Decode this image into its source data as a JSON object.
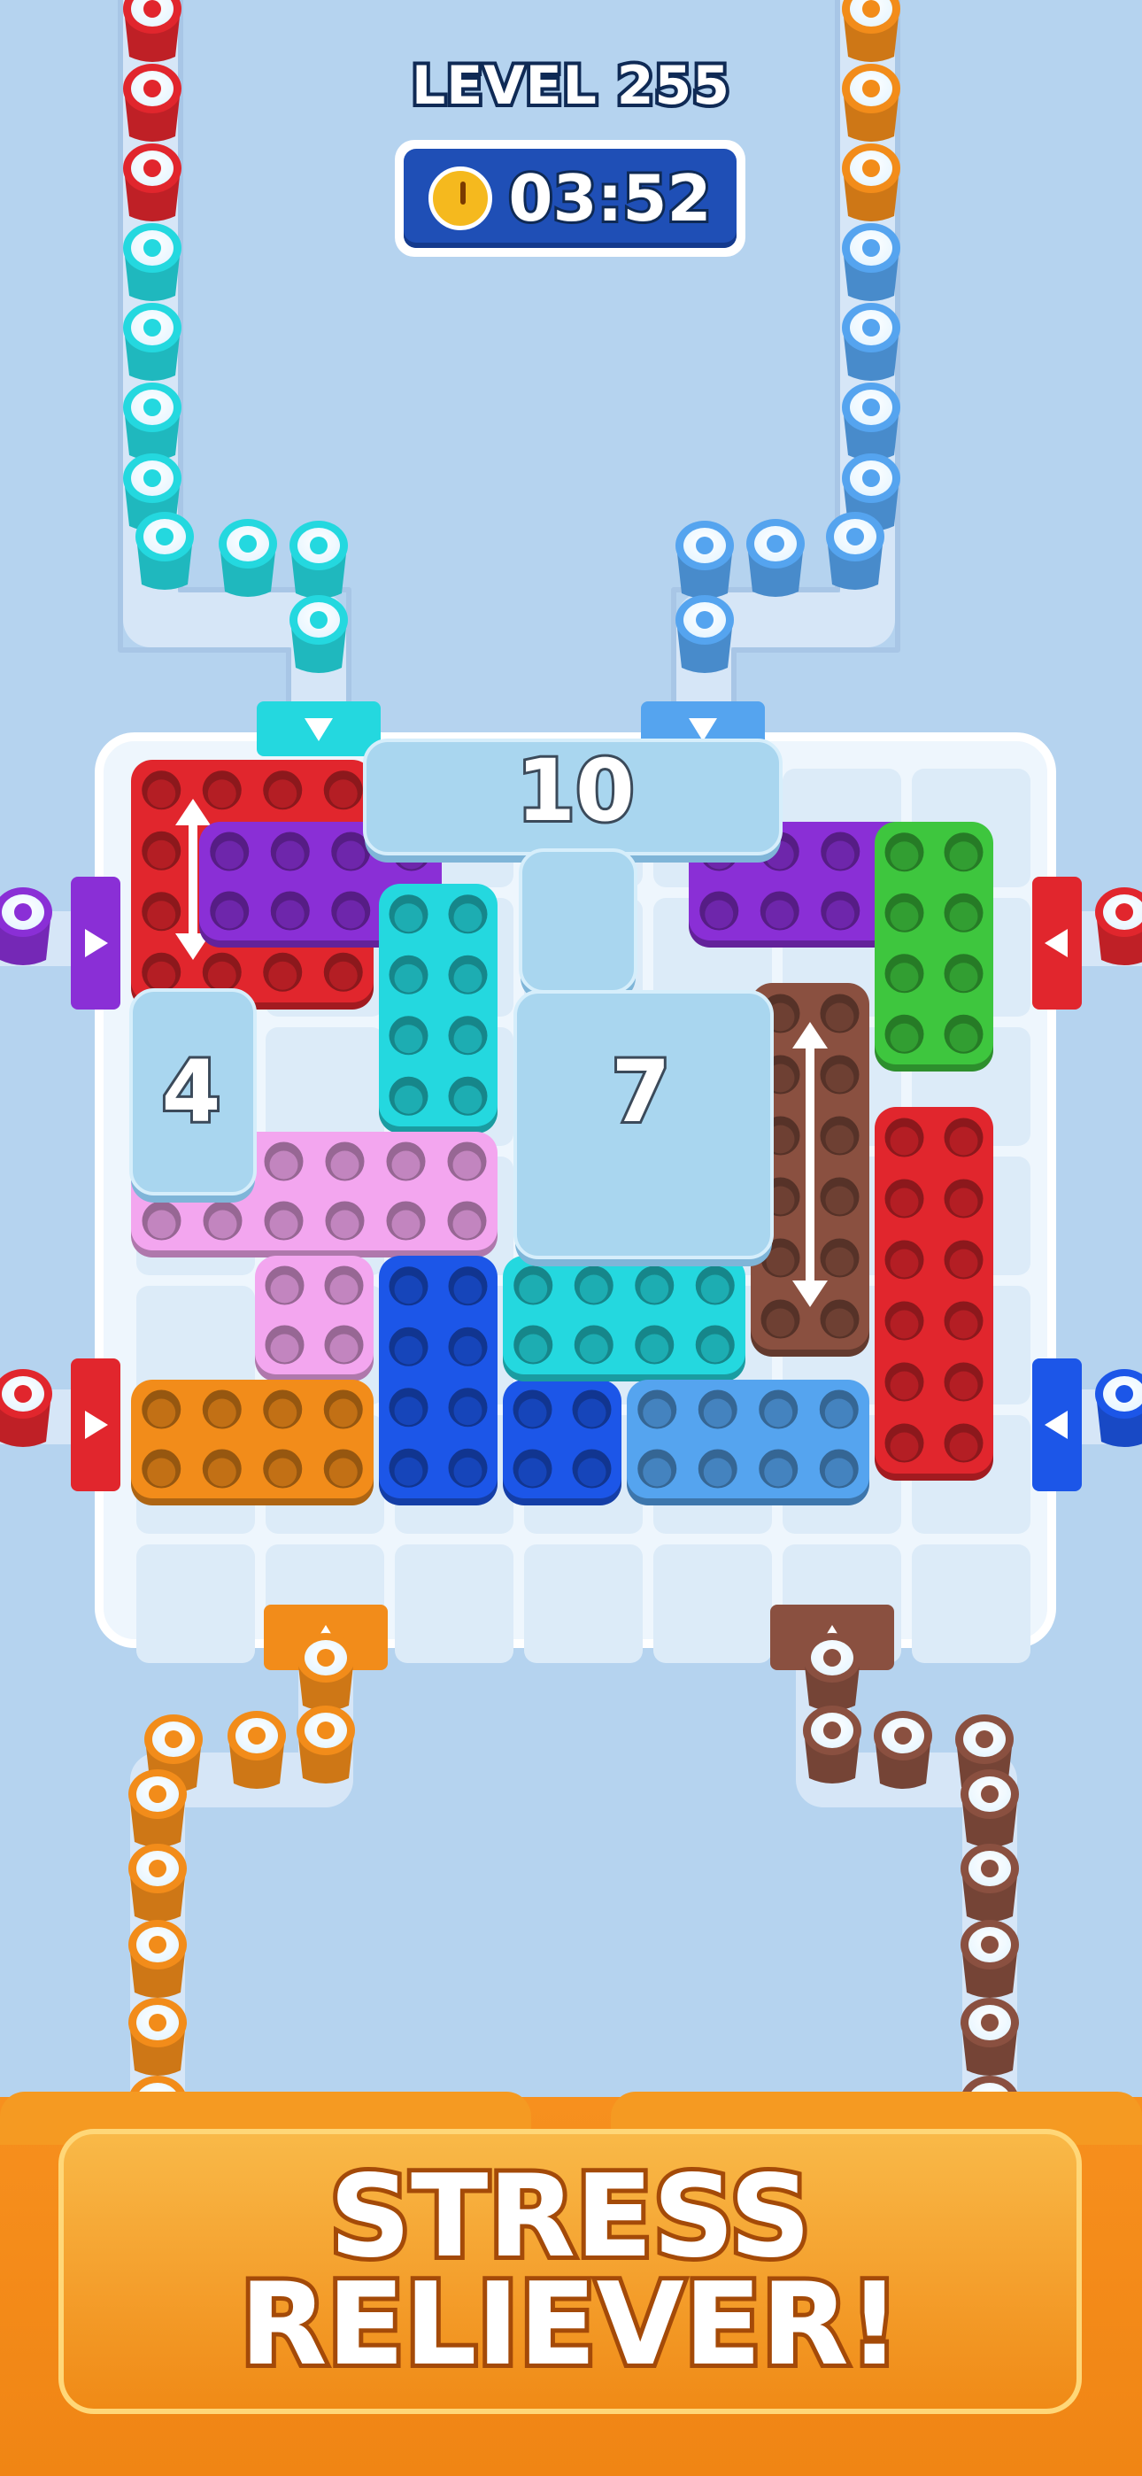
{
  "hud": {
    "level": "LEVEL 255",
    "timer": "03:52",
    "timer_icon": "stopwatch-icon"
  },
  "board": {
    "ice_blocks": [
      {
        "name": "ice-block-10",
        "count": "10"
      },
      {
        "name": "ice-block-4",
        "count": "4"
      },
      {
        "name": "ice-block-7",
        "count": "7"
      }
    ],
    "piece_colors": {
      "red": "#e1262d",
      "purple": "#8a2fd6",
      "green": "#3ec63e",
      "cyan": "#24d8df",
      "pink": "#f3a6ef",
      "blue": "#1c56e8",
      "light_blue": "#55a4ef",
      "orange": "#f28c1a",
      "brown": "#8a5040"
    }
  },
  "banner": {
    "line1": "STRESS",
    "line2": "RELIEVER!"
  }
}
